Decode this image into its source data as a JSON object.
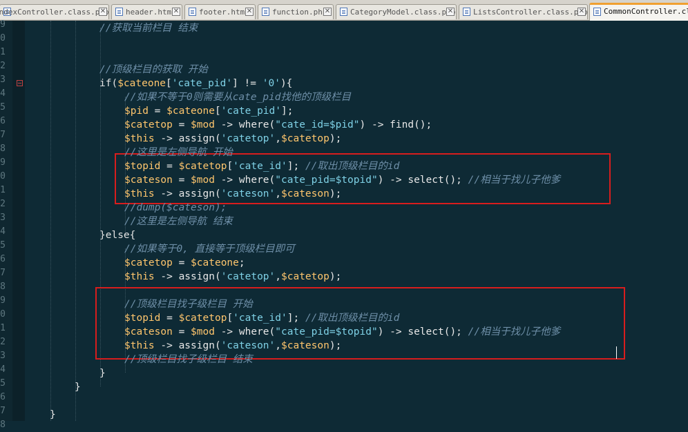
{
  "tabs": [
    {
      "label": "IndexController.class.php",
      "close": "✕",
      "active": false
    },
    {
      "label": "header.html",
      "close": "✕",
      "active": false
    },
    {
      "label": "footer.html",
      "close": "✕",
      "active": false
    },
    {
      "label": "function.php",
      "close": "✕",
      "active": false
    },
    {
      "label": "CategoryModel.class.php",
      "close": "✕",
      "active": false
    },
    {
      "label": "ListsController.class.php",
      "close": "✕",
      "active": false
    },
    {
      "label": "CommonController.class.php",
      "active": true
    }
  ],
  "gutter": {
    "line_numbers": [
      "9",
      "0",
      "1",
      "2",
      "3",
      "4",
      "5",
      "6",
      "7",
      "8",
      "9",
      "0",
      "1",
      "2",
      "3",
      "4",
      "5",
      "6",
      "7",
      "8",
      "9",
      "0",
      "1",
      "2",
      "3",
      "4",
      "5",
      "6",
      "7",
      "8"
    ]
  },
  "code_lines": [
    [
      {
        "t": "//获取当前栏目 结束",
        "c": "cm"
      }
    ],
    [],
    [],
    [
      {
        "t": "//顶级栏目的获取 开始",
        "c": "cm"
      }
    ],
    [
      {
        "t": "if(",
        "c": "kw"
      },
      {
        "t": "$cateone",
        "c": "var"
      },
      {
        "t": "[",
        "c": "pl"
      },
      {
        "t": "'cate_pid'",
        "c": "str"
      },
      {
        "t": "] != ",
        "c": "pl"
      },
      {
        "t": "'0'",
        "c": "str"
      },
      {
        "t": "){",
        "c": "pl"
      }
    ],
    [
      {
        "t": "//如果不等于0则需要从cate_pid找他的顶级栏目",
        "c": "cm"
      }
    ],
    [
      {
        "t": "$pid",
        "c": "var"
      },
      {
        "t": " = ",
        "c": "pl"
      },
      {
        "t": "$cateone",
        "c": "var"
      },
      {
        "t": "[",
        "c": "pl"
      },
      {
        "t": "'cate_pid'",
        "c": "str"
      },
      {
        "t": "];",
        "c": "pl"
      }
    ],
    [
      {
        "t": "$catetop",
        "c": "var"
      },
      {
        "t": " = ",
        "c": "pl"
      },
      {
        "t": "$mod",
        "c": "var"
      },
      {
        "t": " -> where(",
        "c": "pl"
      },
      {
        "t": "\"cate_id=$pid\"",
        "c": "str"
      },
      {
        "t": ") -> find();",
        "c": "pl"
      }
    ],
    [
      {
        "t": "$this",
        "c": "var"
      },
      {
        "t": " -> assign(",
        "c": "pl"
      },
      {
        "t": "'catetop'",
        "c": "str"
      },
      {
        "t": ",",
        "c": "pl"
      },
      {
        "t": "$catetop",
        "c": "var"
      },
      {
        "t": ");",
        "c": "pl"
      }
    ],
    [
      {
        "t": "//这里是左侧导航 开始",
        "c": "cm"
      }
    ],
    [
      {
        "t": "$topid",
        "c": "var"
      },
      {
        "t": " = ",
        "c": "pl"
      },
      {
        "t": "$catetop",
        "c": "var"
      },
      {
        "t": "[",
        "c": "pl"
      },
      {
        "t": "'cate_id'",
        "c": "str"
      },
      {
        "t": "]; ",
        "c": "pl"
      },
      {
        "t": "//取出顶级栏目的id",
        "c": "cm"
      }
    ],
    [
      {
        "t": "$cateson",
        "c": "var"
      },
      {
        "t": " = ",
        "c": "pl"
      },
      {
        "t": "$mod",
        "c": "var"
      },
      {
        "t": " -> where(",
        "c": "pl"
      },
      {
        "t": "\"cate_pid=$topid\"",
        "c": "str"
      },
      {
        "t": ") -> select(); ",
        "c": "pl"
      },
      {
        "t": "//相当于找儿子他爹",
        "c": "cm"
      }
    ],
    [
      {
        "t": "$this",
        "c": "var"
      },
      {
        "t": " -> assign(",
        "c": "pl"
      },
      {
        "t": "'cateson'",
        "c": "str"
      },
      {
        "t": ",",
        "c": "pl"
      },
      {
        "t": "$cateson",
        "c": "var"
      },
      {
        "t": ");",
        "c": "pl"
      }
    ],
    [
      {
        "t": "//dump($cateson);",
        "c": "cm"
      }
    ],
    [
      {
        "t": "//这里是左侧导航 结束",
        "c": "cm"
      }
    ],
    [
      {
        "t": "}else{",
        "c": "kw"
      }
    ],
    [
      {
        "t": "//如果等于0, 直接等于顶级栏目即可",
        "c": "cm"
      }
    ],
    [
      {
        "t": "$catetop",
        "c": "var"
      },
      {
        "t": " = ",
        "c": "pl"
      },
      {
        "t": "$cateone",
        "c": "var"
      },
      {
        "t": ";",
        "c": "pl"
      }
    ],
    [
      {
        "t": "$this",
        "c": "var"
      },
      {
        "t": " -> assign(",
        "c": "pl"
      },
      {
        "t": "'catetop'",
        "c": "str"
      },
      {
        "t": ",",
        "c": "pl"
      },
      {
        "t": "$catetop",
        "c": "var"
      },
      {
        "t": ");",
        "c": "pl"
      }
    ],
    [],
    [
      {
        "t": "//顶级栏目找子级栏目 开始",
        "c": "cm"
      }
    ],
    [
      {
        "t": "$topid",
        "c": "var"
      },
      {
        "t": " = ",
        "c": "pl"
      },
      {
        "t": "$catetop",
        "c": "var"
      },
      {
        "t": "[",
        "c": "pl"
      },
      {
        "t": "'cate_id'",
        "c": "str"
      },
      {
        "t": "]; ",
        "c": "pl"
      },
      {
        "t": "//取出顶级栏目的id",
        "c": "cm"
      }
    ],
    [
      {
        "t": "$cateson",
        "c": "var"
      },
      {
        "t": " = ",
        "c": "pl"
      },
      {
        "t": "$mod",
        "c": "var"
      },
      {
        "t": " -> where(",
        "c": "pl"
      },
      {
        "t": "\"cate_pid=$topid\"",
        "c": "str"
      },
      {
        "t": ") -> select(); ",
        "c": "pl"
      },
      {
        "t": "//相当于找儿子他爹",
        "c": "cm"
      }
    ],
    [
      {
        "t": "$this",
        "c": "var"
      },
      {
        "t": " -> assign(",
        "c": "pl"
      },
      {
        "t": "'cateson'",
        "c": "str"
      },
      {
        "t": ",",
        "c": "pl"
      },
      {
        "t": "$cateson",
        "c": "var"
      },
      {
        "t": ");",
        "c": "pl"
      }
    ],
    [
      {
        "t": "//顶级栏目找子级栏目 结束",
        "c": "cm"
      }
    ],
    [
      {
        "t": "}",
        "c": "pl"
      }
    ],
    [
      {
        "t": "}",
        "c": "pl"
      }
    ],
    [],
    [
      {
        "t": "}",
        "c": "pl"
      }
    ]
  ],
  "colors": {
    "background": "#0e2a35",
    "comment": "#6e8fa8",
    "variable": "#ffc66d",
    "string": "#7fd1e6",
    "highlight_box": "#d81d1d",
    "active_tab_accent": "#f0a030"
  }
}
